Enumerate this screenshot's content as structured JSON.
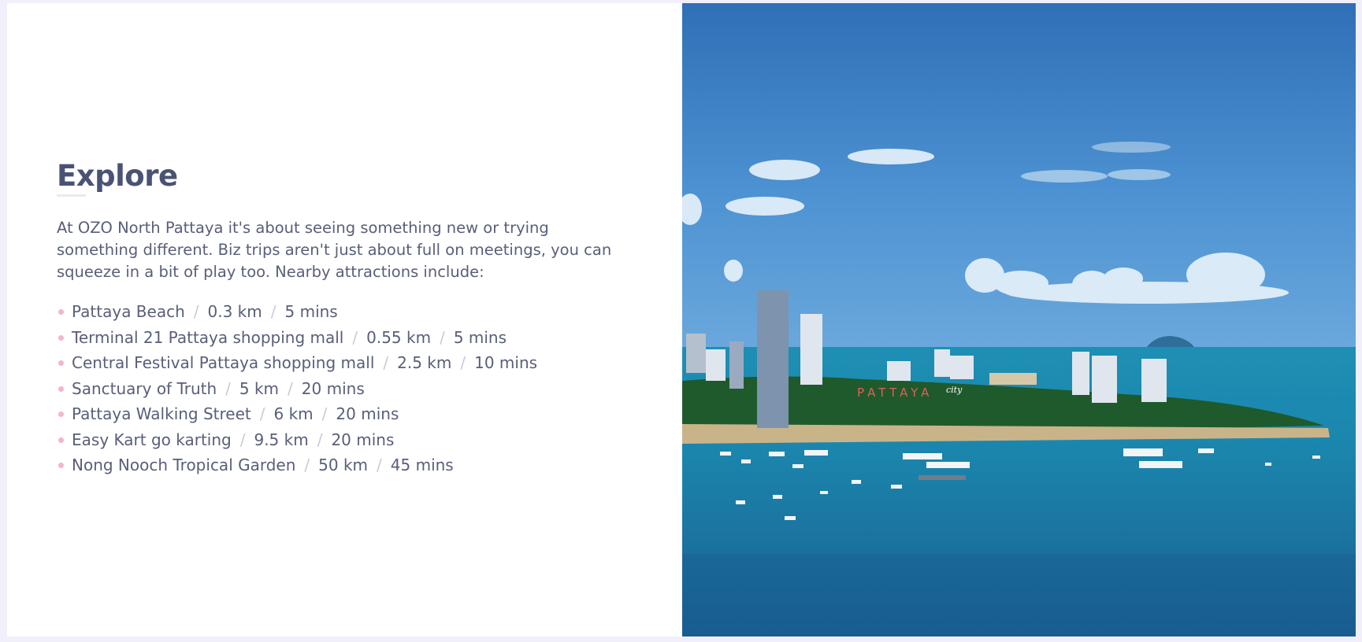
{
  "explore": {
    "heading": "Explore",
    "intro": "At OZO North Pattaya it's about seeing something new or trying something different. Biz trips aren't just about full on meetings, you can squeeze in a bit of play too. Nearby attractions include:",
    "separator": "/",
    "attractions": [
      {
        "name": "Pattaya Beach",
        "distance": "0.3 km",
        "time": "5 mins"
      },
      {
        "name": "Terminal 21 Pattaya shopping mall",
        "distance": "0.55 km",
        "time": "5 mins"
      },
      {
        "name": "Central Festival Pattaya shopping mall",
        "distance": "2.5 km",
        "time": "10 mins"
      },
      {
        "name": "Sanctuary of Truth",
        "distance": "5 km",
        "time": "20 mins"
      },
      {
        "name": "Pattaya Walking Street",
        "distance": "6 km",
        "time": "20 mins"
      },
      {
        "name": "Easy Kart go karting",
        "distance": "9.5 km",
        "time": "20 mins"
      },
      {
        "name": "Nong Nooch Tropical Garden",
        "distance": "50 km",
        "time": "45 mins"
      }
    ]
  },
  "photo": {
    "sign_text": "PATTAYA",
    "sign_script": "city"
  },
  "colors": {
    "heading": "#4a5375",
    "body_text": "#585f78",
    "bullet": "#f4b7c3",
    "page_background": "#f1f0fa"
  }
}
